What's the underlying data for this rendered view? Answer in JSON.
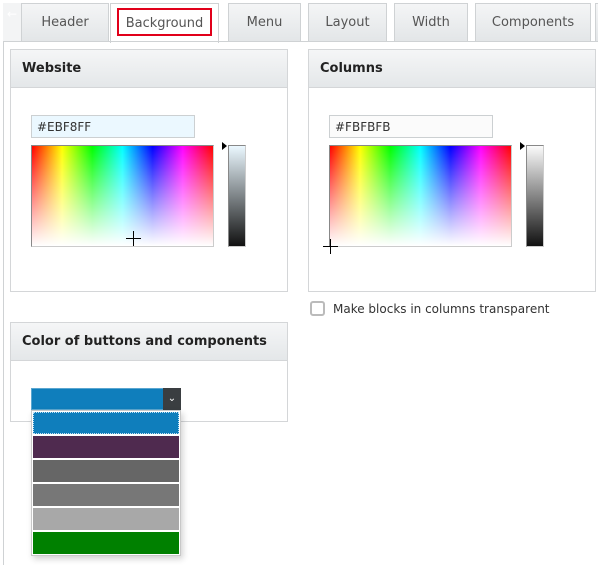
{
  "tabs": [
    {
      "label": "Header",
      "active": false
    },
    {
      "label": "Background",
      "active": true
    },
    {
      "label": "Menu",
      "active": false
    },
    {
      "label": "Layout",
      "active": false
    },
    {
      "label": "Width",
      "active": false
    },
    {
      "label": "Components",
      "active": false
    }
  ],
  "tab_scroll_icon": "arrow-left-icon",
  "website": {
    "title": "Website",
    "hex_value": "#EBF8FF",
    "hex_bg": "#EBF8FF"
  },
  "columns": {
    "title": "Columns",
    "hex_value": "#FBFBFB",
    "hex_bg": "#FBFBFB",
    "transparent_checkbox_label": "Make blocks in columns transparent",
    "transparent_checked": false
  },
  "buttons_color": {
    "title": "Color of buttons and components",
    "selected_color": "#0F7EBC",
    "options": [
      "#0F7EBC",
      "#4F2A4F",
      "#666666",
      "#777777",
      "#A8A8A8",
      "#008000"
    ]
  }
}
